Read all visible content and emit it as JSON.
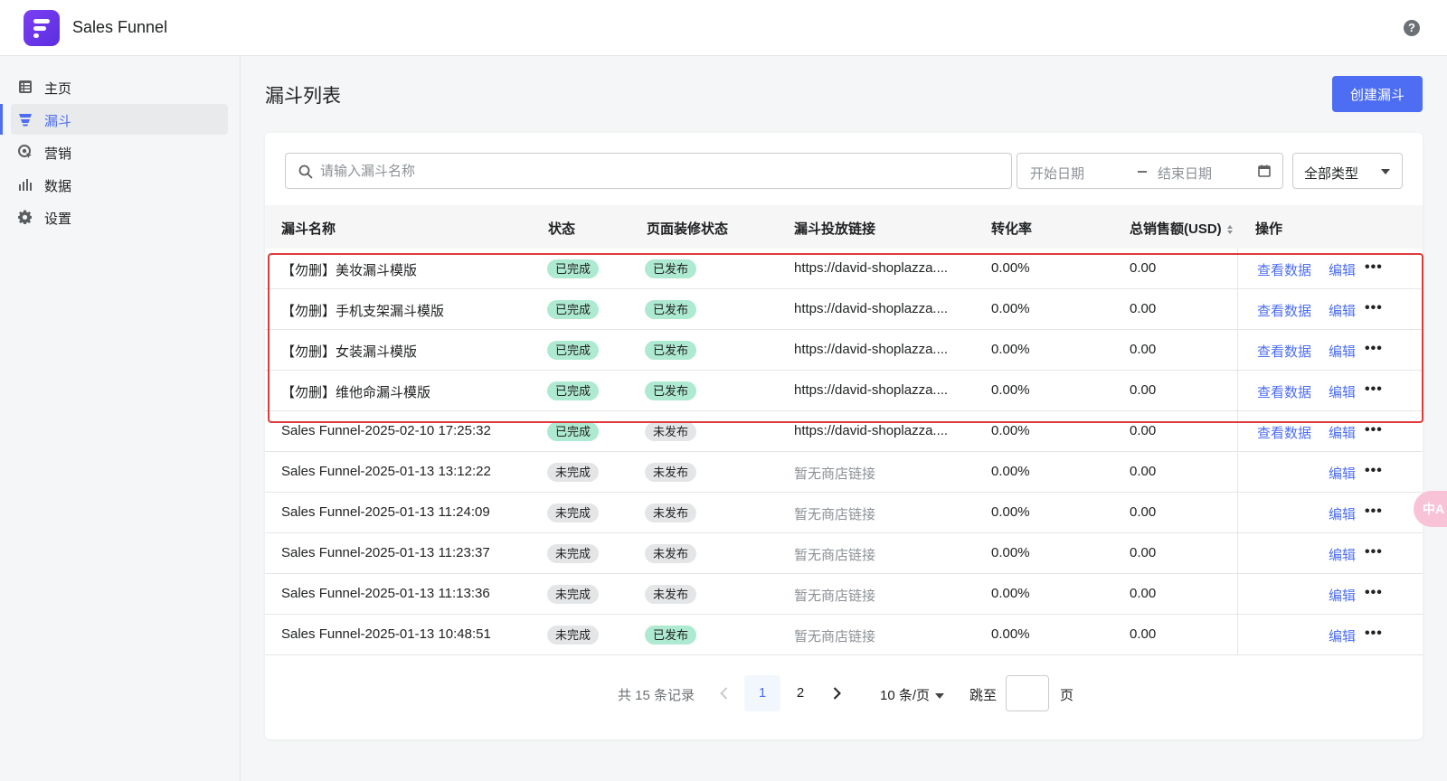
{
  "app": {
    "title": "Sales Funnel",
    "help_icon": "question-circle-icon",
    "help_text": "?"
  },
  "sidebar": {
    "items": [
      {
        "label": "主页",
        "icon": "list-icon",
        "active": false
      },
      {
        "label": "漏斗",
        "icon": "funnel-icon",
        "active": true
      },
      {
        "label": "营销",
        "icon": "marketing-icon",
        "active": false
      },
      {
        "label": "数据",
        "icon": "bar-chart-icon",
        "active": false
      },
      {
        "label": "设置",
        "icon": "gear-icon",
        "active": false
      }
    ]
  },
  "main": {
    "title": "漏斗列表",
    "create_button": "创建漏斗",
    "search_placeholder": "请输入漏斗名称",
    "date_start_placeholder": "开始日期",
    "date_end_placeholder": "结束日期",
    "type_filter": "全部类型"
  },
  "table": {
    "columns": [
      "漏斗名称",
      "状态",
      "页面装修状态",
      "漏斗投放链接",
      "转化率",
      "总销售额(USD)",
      "操作"
    ],
    "action_view": "查看数据",
    "action_edit": "编辑",
    "action_more": "•••",
    "rows": [
      {
        "name": "【勿删】美妆漏斗模版",
        "status": "已完成",
        "status_color": "green",
        "page_status": "已发布",
        "page_color": "green",
        "link": "https://david-shoplazza....",
        "link_muted": false,
        "rate": "0.00%",
        "sales": "0.00",
        "has_view": true
      },
      {
        "name": "【勿删】手机支架漏斗模版",
        "status": "已完成",
        "status_color": "green",
        "page_status": "已发布",
        "page_color": "green",
        "link": "https://david-shoplazza....",
        "link_muted": false,
        "rate": "0.00%",
        "sales": "0.00",
        "has_view": true
      },
      {
        "name": "【勿删】女装漏斗模版",
        "status": "已完成",
        "status_color": "green",
        "page_status": "已发布",
        "page_color": "green",
        "link": "https://david-shoplazza....",
        "link_muted": false,
        "rate": "0.00%",
        "sales": "0.00",
        "has_view": true
      },
      {
        "name": "【勿删】维他命漏斗模版",
        "status": "已完成",
        "status_color": "green",
        "page_status": "已发布",
        "page_color": "green",
        "link": "https://david-shoplazza....",
        "link_muted": false,
        "rate": "0.00%",
        "sales": "0.00",
        "has_view": true
      },
      {
        "name": "Sales Funnel-2025-02-10 17:25:32",
        "status": "已完成",
        "status_color": "green",
        "page_status": "未发布",
        "page_color": "gray",
        "link": "https://david-shoplazza....",
        "link_muted": false,
        "rate": "0.00%",
        "sales": "0.00",
        "has_view": true
      },
      {
        "name": "Sales Funnel-2025-01-13 13:12:22",
        "status": "未完成",
        "status_color": "gray",
        "page_status": "未发布",
        "page_color": "gray",
        "link": "暂无商店链接",
        "link_muted": true,
        "rate": "0.00%",
        "sales": "0.00",
        "has_view": false
      },
      {
        "name": "Sales Funnel-2025-01-13 11:24:09",
        "status": "未完成",
        "status_color": "gray",
        "page_status": "未发布",
        "page_color": "gray",
        "link": "暂无商店链接",
        "link_muted": true,
        "rate": "0.00%",
        "sales": "0.00",
        "has_view": false
      },
      {
        "name": "Sales Funnel-2025-01-13 11:23:37",
        "status": "未完成",
        "status_color": "gray",
        "page_status": "未发布",
        "page_color": "gray",
        "link": "暂无商店链接",
        "link_muted": true,
        "rate": "0.00%",
        "sales": "0.00",
        "has_view": false
      },
      {
        "name": "Sales Funnel-2025-01-13 11:13:36",
        "status": "未完成",
        "status_color": "gray",
        "page_status": "未发布",
        "page_color": "gray",
        "link": "暂无商店链接",
        "link_muted": true,
        "rate": "0.00%",
        "sales": "0.00",
        "has_view": false
      },
      {
        "name": "Sales Funnel-2025-01-13 10:48:51",
        "status": "未完成",
        "status_color": "gray",
        "page_status": "已发布",
        "page_color": "green",
        "link": "暂无商店链接",
        "link_muted": true,
        "rate": "0.00%",
        "sales": "0.00",
        "has_view": false
      }
    ]
  },
  "pagination": {
    "total": "共 15 条记录",
    "pages": [
      "1",
      "2"
    ],
    "current": "1",
    "page_size": "10 条/页",
    "jump_label": "跳至",
    "page_unit": "页"
  },
  "translate_fab": {
    "icon": "translate-icon",
    "text": "中A"
  },
  "colors": {
    "accent": "#4d6ef2",
    "badge_green": "#aee9d1",
    "badge_gray": "#e4e5e7",
    "highlight": "#e03a3a"
  }
}
